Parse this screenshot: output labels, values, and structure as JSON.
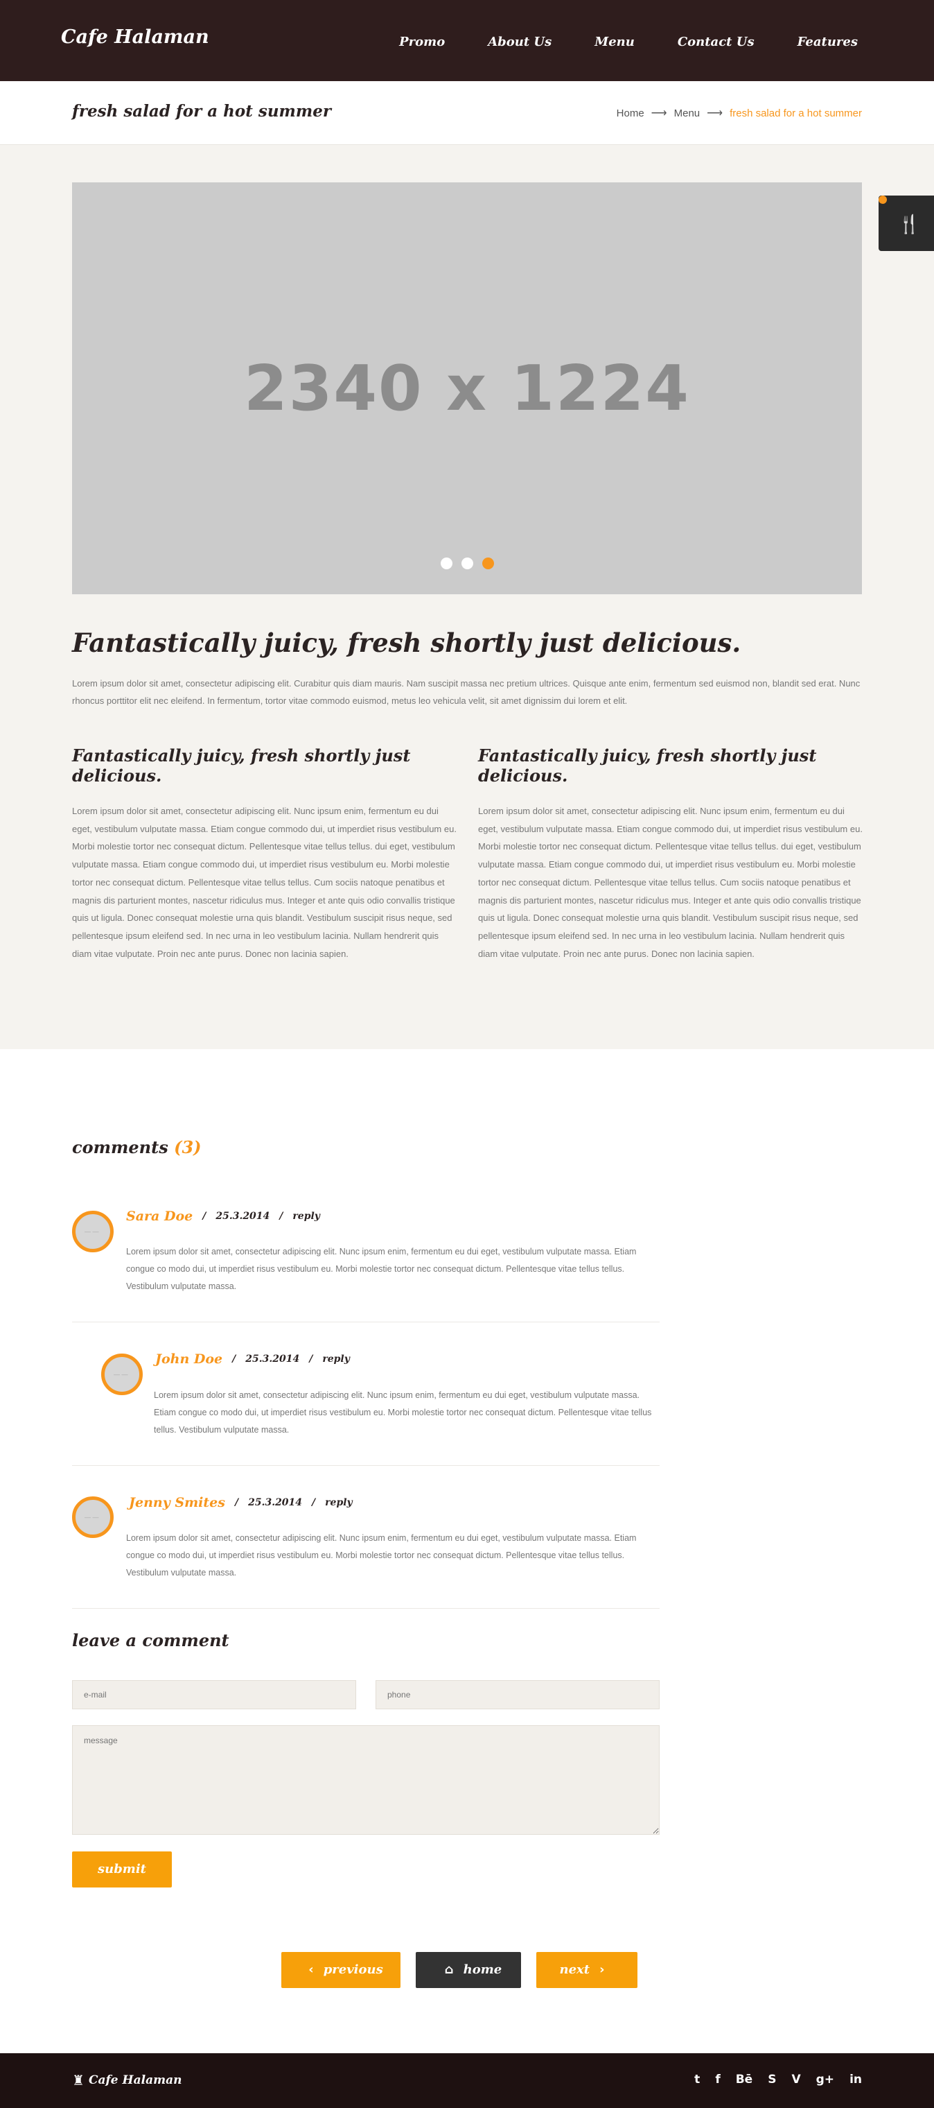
{
  "header": {
    "logo": "Cafe Halaman",
    "nav": [
      "Promo",
      "About Us",
      "Menu",
      "Contact Us",
      "Features"
    ]
  },
  "titlebar": {
    "title": "fresh salad for a hot summer",
    "breadcrumb": [
      "Home",
      "Menu",
      "fresh salad for a hot summer"
    ]
  },
  "slider": {
    "placeholder": "2340 x 1224",
    "dots": 3,
    "active_dot": 3
  },
  "article": {
    "title": "Fantastically juicy, fresh shortly just delicious.",
    "intro": "Lorem ipsum dolor sit amet, consectetur adipiscing elit. Curabitur quis diam mauris. Nam suscipit massa nec pretium ultrices. Quisque ante enim, fermentum sed euismod non, blandit sed erat. Nunc rhoncus porttitor elit nec eleifend. In fermentum, tortor vitae commodo euismod, metus leo vehicula velit, sit amet dignissim dui lorem et elit.",
    "columns": [
      {
        "title": "Fantastically juicy, fresh shortly just delicious.",
        "text": "Lorem ipsum dolor sit amet, consectetur adipiscing elit. Nunc ipsum enim, fermentum eu dui eget, vestibulum vulputate massa. Etiam congue commodo dui, ut imperdiet risus vestibulum eu. Morbi molestie tortor nec consequat dictum. Pellentesque vitae tellus tellus. dui eget, vestibulum vulputate massa. Etiam congue commodo dui, ut imperdiet risus vestibulum eu. Morbi molestie tortor nec consequat dictum. Pellentesque vitae tellus tellus. Cum sociis natoque penatibus et magnis dis parturient montes, nascetur ridiculus mus. Integer et ante quis odio convallis tristique quis ut ligula. Donec consequat molestie urna quis blandit. Vestibulum suscipit risus neque, sed pellentesque ipsum eleifend sed. In nec urna in leo vestibulum lacinia. Nullam hendrerit quis diam vitae vulputate. Proin nec ante purus. Donec non lacinia sapien."
      },
      {
        "title": "Fantastically juicy, fresh shortly just delicious.",
        "text": "Lorem ipsum dolor sit amet, consectetur adipiscing elit. Nunc ipsum enim, fermentum eu dui eget, vestibulum vulputate massa. Etiam congue commodo dui, ut imperdiet risus vestibulum eu. Morbi molestie tortor nec consequat dictum. Pellentesque vitae tellus tellus. dui eget, vestibulum vulputate massa. Etiam congue commodo dui, ut imperdiet risus vestibulum eu. Morbi molestie tortor nec consequat dictum. Pellentesque vitae tellus tellus. Cum sociis natoque penatibus et magnis dis parturient montes, nascetur ridiculus mus. Integer et ante quis odio convallis tristique quis ut ligula. Donec consequat molestie urna quis blandit. Vestibulum suscipit risus neque, sed pellentesque ipsum eleifend sed. In nec urna in leo vestibulum lacinia. Nullam hendrerit quis diam vitae vulputate. Proin nec ante purus. Donec non lacinia sapien."
      }
    ]
  },
  "comments": {
    "title": "comments",
    "count": "(3)",
    "avatar_text": "— —",
    "items": [
      {
        "name": "Sara Doe",
        "date": "25.3.2014",
        "reply": "reply",
        "text": "Lorem ipsum dolor sit amet, consectetur adipiscing elit. Nunc ipsum enim, fermentum eu dui eget, vestibulum vulputate massa. Etiam congue co modo dui, ut imperdiet risus vestibulum eu. Morbi molestie tortor nec consequat dictum. Pellentesque vitae tellus tellus. Vestibulum vulputate massa."
      },
      {
        "name": "John Doe",
        "date": "25.3.2014",
        "reply": "reply",
        "text": "Lorem ipsum dolor sit amet, consectetur adipiscing elit. Nunc ipsum enim, fermentum eu dui eget, vestibulum vulputate massa. Etiam congue co modo dui, ut imperdiet risus vestibulum eu. Morbi molestie tortor nec consequat dictum. Pellentesque vitae tellus tellus. Vestibulum vulputate massa."
      },
      {
        "name": "Jenny Smites",
        "date": "25.3.2014",
        "reply": "reply",
        "text": "Lorem ipsum dolor sit amet, consectetur adipiscing elit. Nunc ipsum enim, fermentum eu dui eget, vestibulum vulputate massa. Etiam congue co modo dui, ut imperdiet risus vestibulum eu. Morbi molestie tortor nec consequat dictum. Pellentesque vitae tellus tellus. Vestibulum vulputate massa."
      }
    ]
  },
  "form": {
    "title": "leave a comment",
    "email_placeholder": "e-mail",
    "phone_placeholder": "phone",
    "message_placeholder": "message",
    "submit": "submit"
  },
  "pager": {
    "previous": "previous",
    "home": "home",
    "next": "next"
  },
  "footer": {
    "logo": "Cafe Halaman",
    "social": [
      "twitter-icon",
      "facebook-icon",
      "behance-icon",
      "skype-icon",
      "vimeo-icon",
      "google-plus-icon",
      "linkedin-icon"
    ]
  },
  "colors": {
    "header_bg": "#2f1d1d",
    "accent": "#f7961d",
    "main_bg": "#f5f3ef",
    "footer_bg": "#1e1111"
  }
}
